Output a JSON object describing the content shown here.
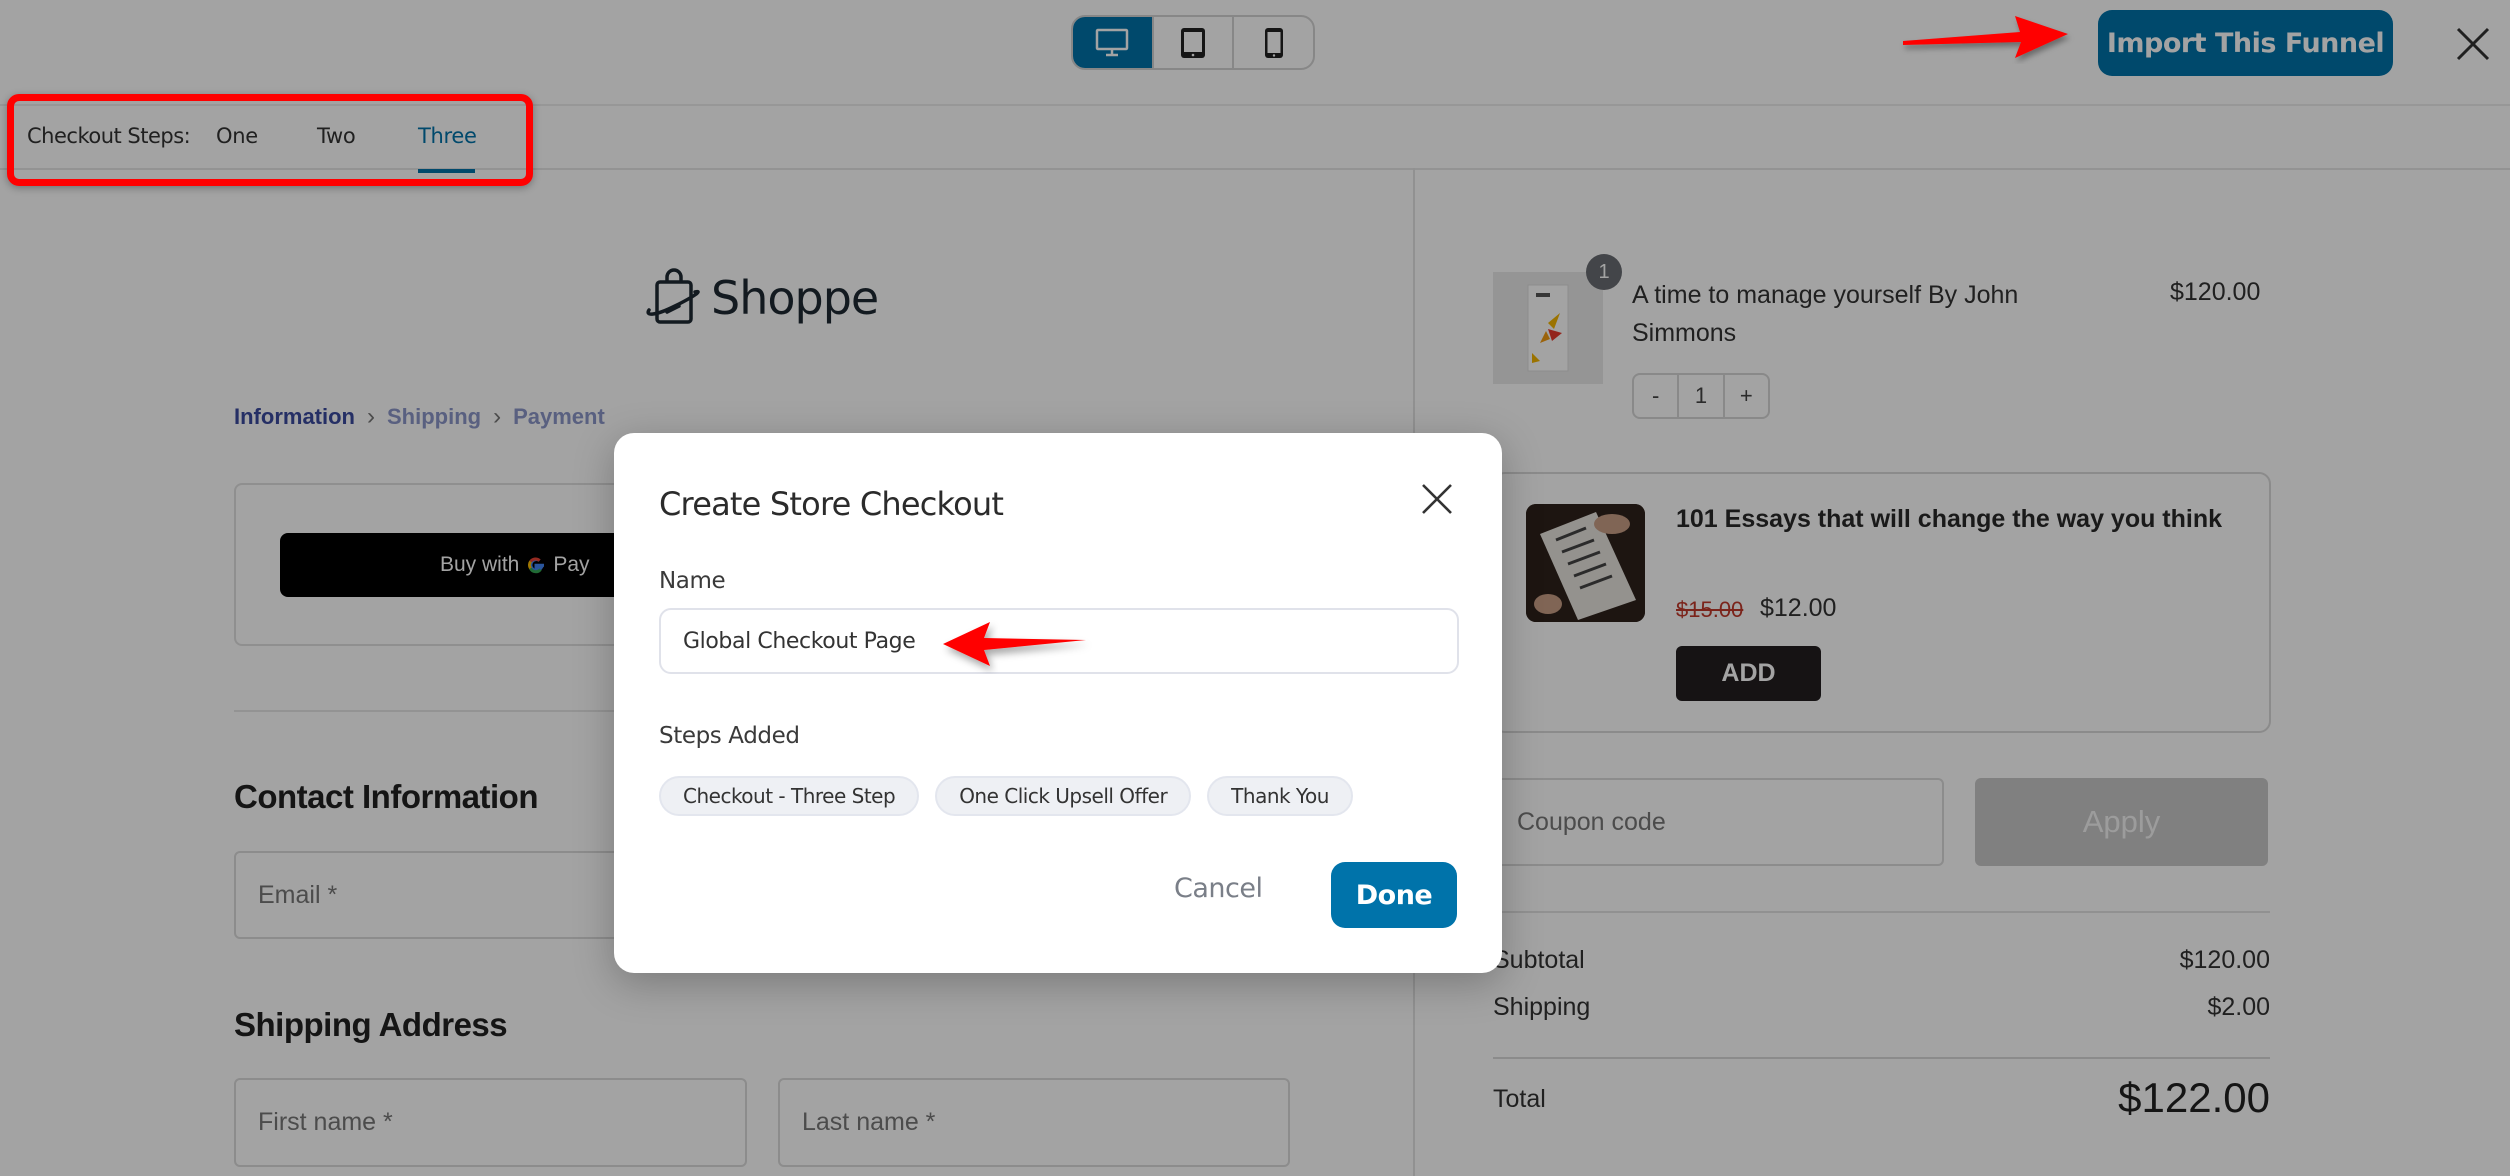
{
  "topbar": {
    "device_toggle": [
      {
        "name": "desktop",
        "icon": "desktop-icon",
        "active": true
      },
      {
        "name": "tablet",
        "icon": "tablet-icon",
        "active": false
      },
      {
        "name": "mobile",
        "icon": "mobile-icon",
        "active": false
      }
    ],
    "import_label": "Import This Funnel",
    "close_icon": "close-icon"
  },
  "steps_bar": {
    "label": "Checkout Steps:",
    "tabs": [
      {
        "label": "One",
        "active": false
      },
      {
        "label": "Two",
        "active": false
      },
      {
        "label": "Three",
        "active": true
      }
    ]
  },
  "checkout": {
    "logo_text": "Shoppe",
    "breadcrumb": [
      "Information",
      "Shipping",
      "Payment"
    ],
    "express_pay": {
      "prefix": "Buy with",
      "brand": "Pay"
    },
    "contact_heading": "Contact Information",
    "email_placeholder": "Email *",
    "shipping_heading": "Shipping Address",
    "first_name_placeholder": "First name *",
    "last_name_placeholder": "Last name *"
  },
  "order_summary": {
    "item": {
      "quantity_badge": "1",
      "title": "A time to manage yourself By John Simmons",
      "price": "$120.00",
      "qty_minus": "-",
      "qty_value": "1",
      "qty_plus": "+"
    },
    "order_bump": {
      "title": "101 Essays that will change the way you think",
      "old_price": "$15.00",
      "new_price": "$12.00",
      "add_label": "ADD"
    },
    "coupon_placeholder": "Coupon code",
    "apply_label": "Apply",
    "subtotal_label": "Subtotal",
    "subtotal_value": "$120.00",
    "shipping_label": "Shipping",
    "shipping_value": "$2.00",
    "total_label": "Total",
    "total_value": "$122.00"
  },
  "modal": {
    "title": "Create Store Checkout",
    "name_label": "Name",
    "name_value": "Global Checkout Page",
    "steps_label": "Steps Added",
    "steps": [
      "Checkout - Three Step",
      "One Click Upsell Offer",
      "Thank You"
    ],
    "cancel_label": "Cancel",
    "done_label": "Done"
  },
  "colors": {
    "primary": "#0073aa",
    "annotation_red": "#ff0000",
    "overlay": "rgba(0,0,0,0.36)"
  }
}
